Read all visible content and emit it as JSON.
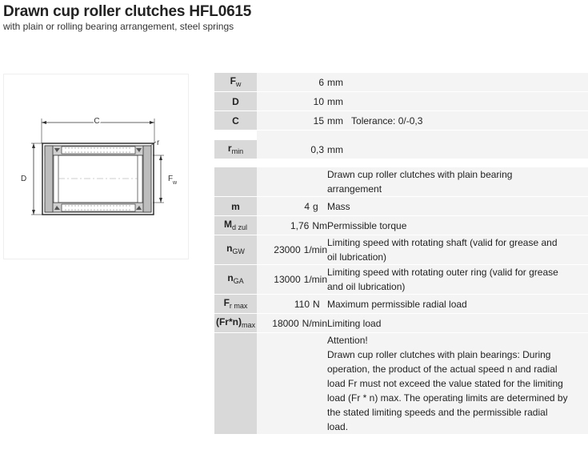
{
  "header": {
    "title": "Drawn cup roller clutches HFL0615",
    "subtitle": "with plain or rolling bearing arrangement, steel springs"
  },
  "drawing": {
    "labels": {
      "c": "C",
      "r": "r",
      "d": "D",
      "fw": "F",
      "fw_sub": "w"
    }
  },
  "specs": {
    "fw": {
      "sym": "F",
      "sub": "w",
      "value": "6",
      "unit": "mm",
      "desc": ""
    },
    "d": {
      "sym": "D",
      "value": "10",
      "unit": "mm",
      "desc": ""
    },
    "c": {
      "sym": "C",
      "value": "15",
      "unit": "mm",
      "desc": "Tolerance: 0/-0,3"
    },
    "rmin": {
      "sym": "r",
      "sub": "min",
      "value": "0,3",
      "unit": "mm",
      "desc": ""
    },
    "variant_desc_1": "Drawn cup roller clutches with plain bearing",
    "variant_desc_2": "arrangement",
    "m": {
      "sym": "m",
      "value": "4",
      "unit": "g",
      "desc": "Mass"
    },
    "md": {
      "sym": "M",
      "sub": "d zul",
      "value": "1,76",
      "unit": "Nm",
      "desc": "Permissible torque"
    },
    "ngw": {
      "sym": "n",
      "sub": "GW",
      "value": "23000",
      "unit": "1/min",
      "desc_1": "Limiting speed with rotating shaft (valid for grease and",
      "desc_2": "oil lubrication)"
    },
    "nga": {
      "sym": "n",
      "sub": "GA",
      "value": "13000",
      "unit": "1/min",
      "desc_1": "Limiting speed with rotating outer ring (valid for grease",
      "desc_2": "and oil lubrication)"
    },
    "frmax": {
      "sym": "F",
      "sub": "r max",
      "value": "110",
      "unit": "N",
      "desc": "Maximum permissible radial load"
    },
    "frn": {
      "sym": "(Fr*n)",
      "sub": "max",
      "value": "18000",
      "unit": "N/min",
      "desc": "Limiting load"
    },
    "note": {
      "line1": "Attention!",
      "line2": "Drawn cup roller clutches with plain bearings: During",
      "line3": "operation, the product of the actual speed n and radial",
      "line4": "load Fr must not exceed the value stated for the limiting",
      "line5": "load (Fr * n) max. The operating limits are determined by",
      "line6": "the stated limiting speeds and the permissible radial",
      "line7": "load."
    }
  }
}
